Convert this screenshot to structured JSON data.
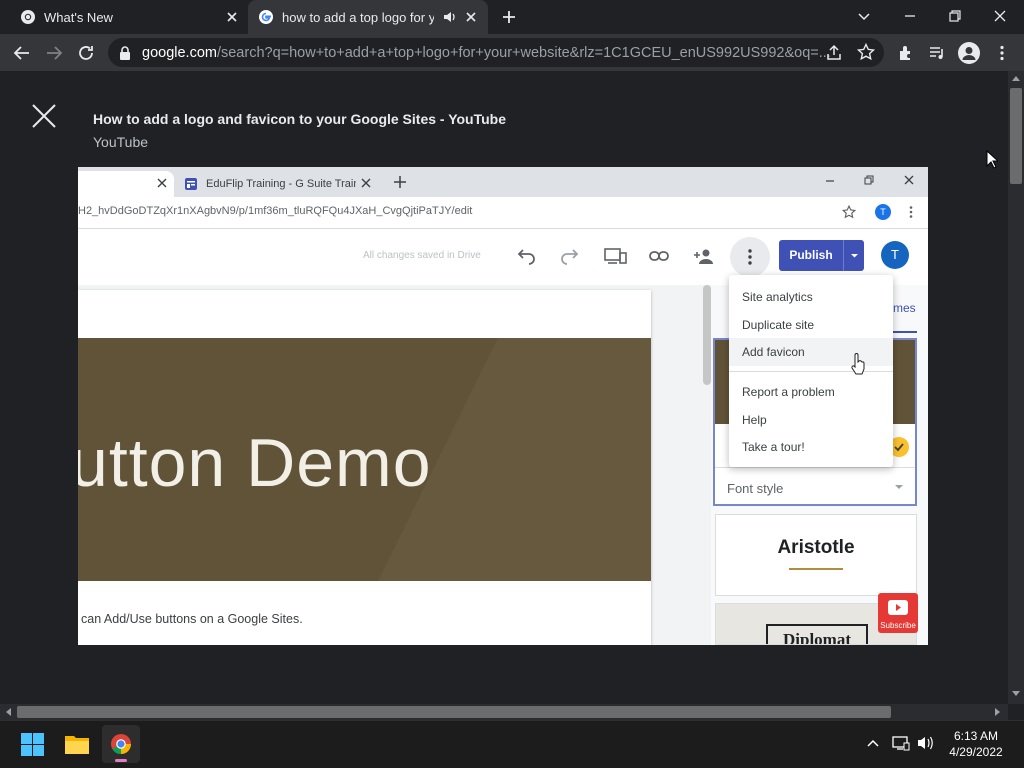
{
  "browser": {
    "tabs": [
      {
        "title": "What's New"
      },
      {
        "title": "how to add a top logo for yo"
      }
    ],
    "url_host": "google.com",
    "url_path": "/search?q=how+to+add+a+top+logo+for+your+website&rlz=1C1GCEU_enUS992US992&oq=..."
  },
  "viewer": {
    "video_title": "How to add a logo and favicon to your Google Sites - YouTube",
    "source": "YouTube"
  },
  "video": {
    "tab_title": "EduFlip Training - G Suite Trainin",
    "address": "H2_hvDdGoDTZqXr1nXAgbvN9/p/1mf36m_tluRQFQu4JXaH_CvgQjtiPaTJY/edit",
    "profile_initial": "T",
    "status": "All changes saved in Drive",
    "publish_label": "Publish",
    "avatar_initial": "T",
    "menu_items": [
      "Site analytics",
      "Duplicate site",
      "Add favicon",
      "Report a problem",
      "Help",
      "Take a tour!"
    ],
    "banner_text": "utton Demo",
    "body_text": "can Add/Use buttons on a Google Sites.",
    "themes_tab": "mes",
    "font_style_label": "Font style",
    "theme_names": [
      "Aristotle",
      "Diplomat"
    ],
    "subscribe_label": "Subscribe"
  },
  "taskbar": {
    "time": "6:13 AM",
    "date": "4/29/2022"
  },
  "colors": {
    "accent_blue": "#3f51b5",
    "banner": "#615338",
    "chrome_dark": "#202124"
  }
}
